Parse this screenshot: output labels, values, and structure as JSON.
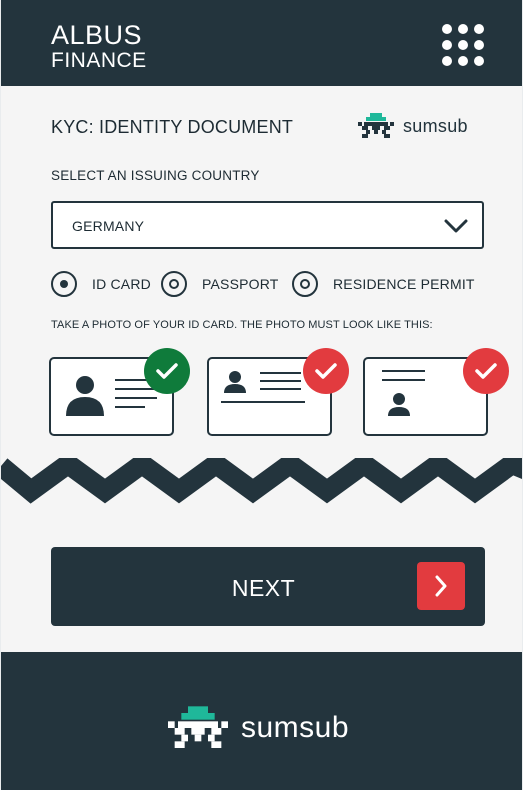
{
  "header": {
    "brand_line1": "ALBUS",
    "brand_line2": "FINANCE",
    "menu_icon": "grid-menu-icon"
  },
  "main": {
    "title": "KYC: IDENTITY DOCUMENT",
    "provider": "sumsub",
    "country_label": "SELECT AN ISSUING COUNTRY",
    "country_value": "GERMANY",
    "document_types": [
      {
        "label": "ID CARD",
        "selected": true
      },
      {
        "label": "PASSPORT",
        "selected": false
      },
      {
        "label": "RESIDENCE PERMIT",
        "selected": false
      }
    ],
    "instruction": "TAKE A PHOTO OF YOUR ID CARD. THE PHOTO MUST LOOK LIKE THIS:",
    "examples": [
      {
        "name": "correct-example",
        "status": "good",
        "icon": "check-icon"
      },
      {
        "name": "wrong-example-1",
        "status": "bad",
        "icon": "check-icon"
      },
      {
        "name": "wrong-example-2",
        "status": "bad",
        "icon": "check-icon"
      }
    ],
    "next_label": "NEXT",
    "next_icon": "chevron-right-icon"
  },
  "footer": {
    "provider": "sumsub"
  },
  "colors": {
    "dark": "#23343d",
    "good": "#0f7b3b",
    "bad": "#e23b3f",
    "teal": "#1fb89a",
    "background": "#f5f5f5"
  }
}
